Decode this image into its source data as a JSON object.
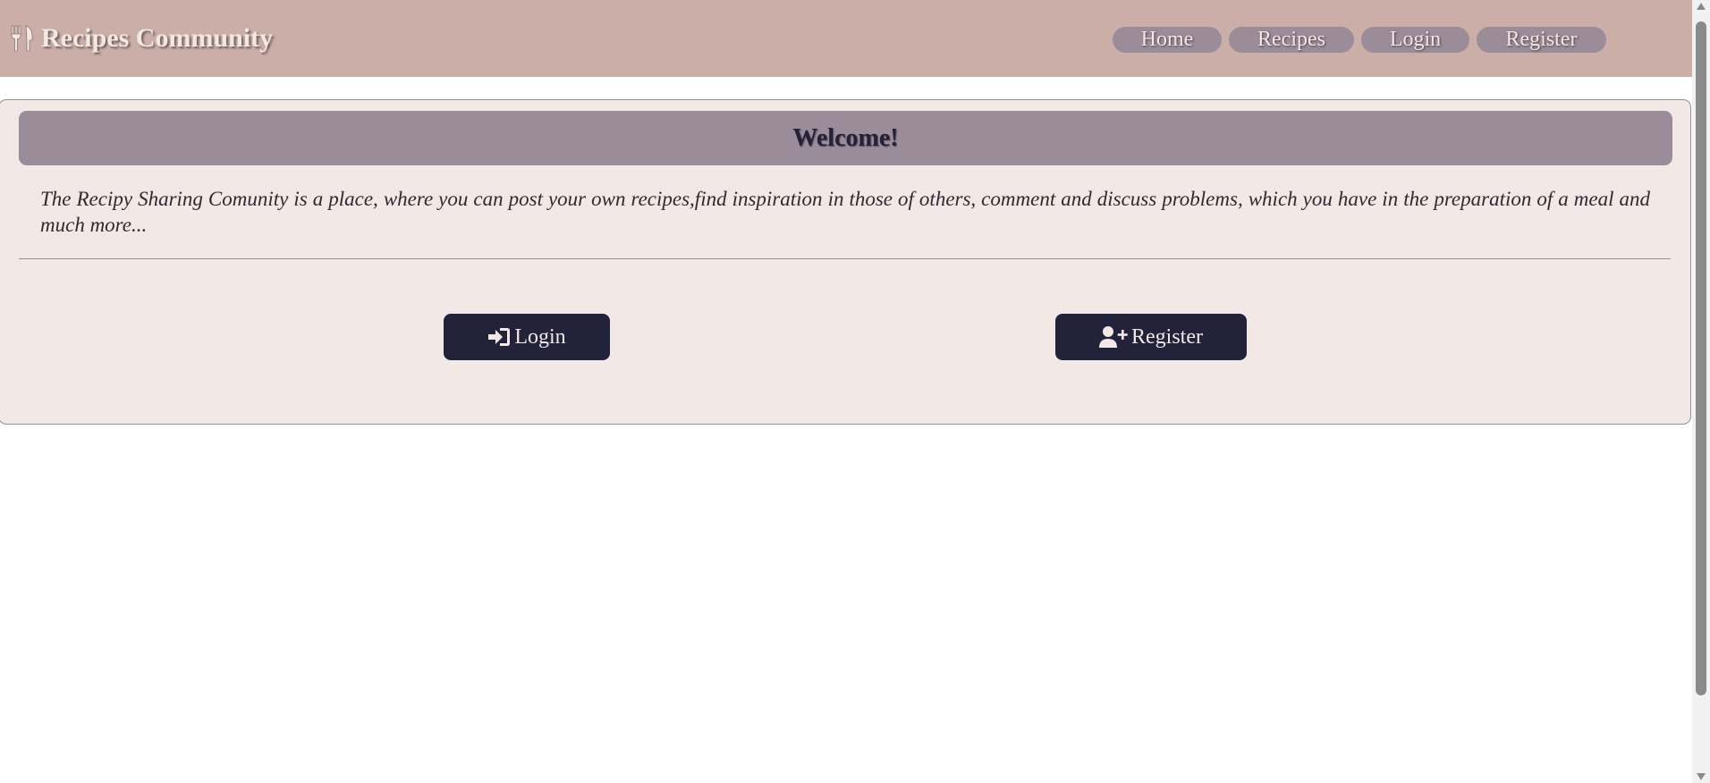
{
  "header": {
    "brand_name": "Recipes Community",
    "brand_icon": "utensils-icon",
    "nav": [
      "Home",
      "Recipes",
      "Login",
      "Register"
    ]
  },
  "main": {
    "welcome_title": "Welcome!",
    "intro_text": "The Recipy Sharing Comunity is a place, where you can post your own recipes,find inspiration in those of others, comment and discuss problems, which you have in the preparation of a meal and much more...",
    "login_label": "Login",
    "login_icon": "sign-in-icon",
    "register_label": "Register",
    "register_icon": "user-plus-icon"
  },
  "colors": {
    "header_bg": "#caaea7",
    "card_bg": "#f2e8e5",
    "accent": "#9a8c99",
    "button_bg": "#22223b",
    "light_text": "#f3e7e4"
  }
}
